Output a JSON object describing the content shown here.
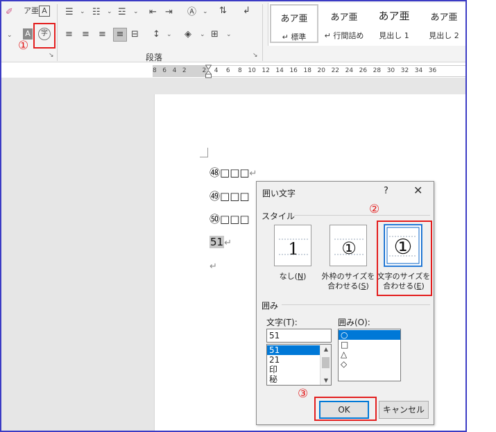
{
  "ribbon": {
    "group_label": "段落",
    "styles": [
      {
        "sample": "あア亜",
        "name": "↵ 標準"
      },
      {
        "sample": "あア亜",
        "name": "↵ 行間詰め"
      },
      {
        "sample": "あア亜",
        "name": "見出し 1"
      },
      {
        "sample": "あア亜",
        "name": "見出し 2"
      }
    ]
  },
  "ruler": {
    "labels": "8   6   4   2        2    4    6    8   10   12   14   16   18   20   22   24   26   28   30   32   34   36"
  },
  "document": {
    "lines": [
      {
        "prefix": "㊽",
        "boxes": "□□□",
        "ret": "↵"
      },
      {
        "prefix": "㊾",
        "boxes": "□□□",
        "ret": ""
      },
      {
        "prefix": "㊿",
        "boxes": "□□□",
        "ret": ""
      },
      {
        "prefix": "51",
        "boxes": "",
        "ret": "↵"
      },
      {
        "prefix": "",
        "boxes": "",
        "ret": "↵"
      }
    ]
  },
  "annotations": [
    "①",
    "②",
    "③"
  ],
  "dialog": {
    "title": "囲い文字",
    "help": "?",
    "close": "✕",
    "style_section": "スタイル",
    "options": [
      {
        "caption_top": "なし(",
        "key": "N",
        "caption_tail": ")",
        "caption_line2": "",
        "glyph": "1"
      },
      {
        "caption_top": "外枠のサイズを",
        "key": "S",
        "caption_line2": "合わせる(",
        "caption_tail": ")",
        "glyph": "①"
      },
      {
        "caption_top": "文字のサイズを",
        "key": "E",
        "caption_line2": "合わせる(",
        "caption_tail": ")",
        "glyph": "①"
      }
    ],
    "enclose_section": "囲み",
    "text_label": "文字(T):",
    "text_value": "51",
    "text_list": [
      "51",
      "21",
      "印",
      "秘"
    ],
    "shape_label": "囲み(O):",
    "shape_list": [
      "○",
      "□",
      "△",
      "◇"
    ],
    "ok_label": "OK",
    "cancel_label": "キャンセル"
  }
}
